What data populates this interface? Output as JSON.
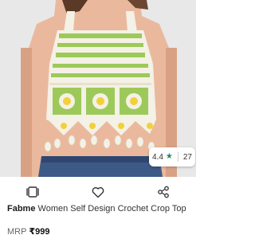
{
  "product": {
    "brand": "Fabme",
    "title": "Women Self Design Crochet Crop Top",
    "mrp_label": "MRP",
    "price": "₹999",
    "rating": 4.4,
    "rating_text": "4.4",
    "review_count": "27"
  },
  "colors": {
    "rating_star": "#1f8a5b",
    "crochet_green": "#9dc95a",
    "crochet_yellow": "#f2d03a",
    "crochet_cream": "#f4f1e6"
  },
  "icons": {
    "similar": "similar-products-icon",
    "wishlist": "heart-icon",
    "share": "share-icon"
  }
}
